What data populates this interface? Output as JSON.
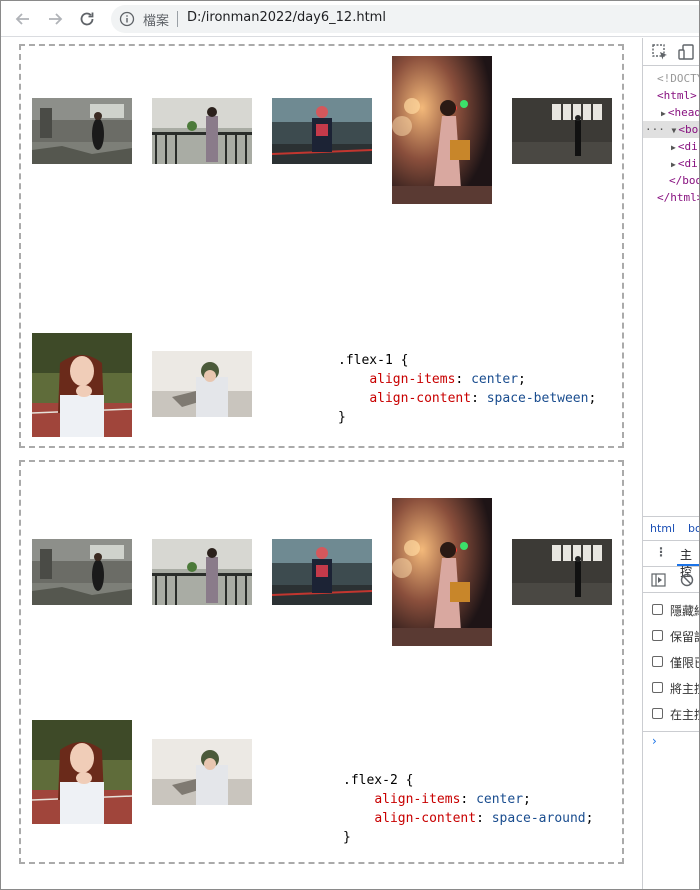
{
  "browser": {
    "scheme_label": "檔案",
    "url": "D:/ironman2022/day6_12.html"
  },
  "sections": [
    {
      "code": {
        "selector": ".flex-1 {",
        "prop1": "align-items",
        "val1": "center",
        "prop2": "align-content",
        "val2": "space-between",
        "close": "}"
      }
    },
    {
      "code": {
        "selector": ".flex-2 {",
        "prop1": "align-items",
        "val1": "center",
        "prop2": "align-content",
        "val2": "space-around",
        "close": "}"
      }
    }
  ],
  "devtools": {
    "dom": {
      "doctype": "<!DOCTY",
      "html_open": "<html>",
      "head": "<head",
      "body": "<body",
      "div1": "<di",
      "div2": "<di",
      "body_close": "</bod",
      "html_close": "</html>"
    },
    "tabs": {
      "html": "html",
      "body": "bo"
    },
    "drawer_label": "主控",
    "options": [
      "隱藏網",
      "保留記",
      "僅限已",
      "將主控",
      "在主控"
    ],
    "prompt": "›"
  }
}
